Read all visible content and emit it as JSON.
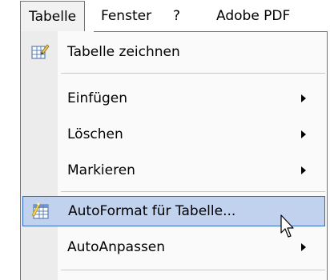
{
  "menubar": {
    "items": [
      {
        "label": "Tabelle"
      },
      {
        "label": "Fenster"
      },
      {
        "label": "?"
      },
      {
        "label": "Adobe PDF"
      }
    ]
  },
  "menu": {
    "items": [
      {
        "label": "Tabelle zeichnen",
        "icon": "pencil-table-icon"
      },
      {
        "label": "Einfügen",
        "submenu": true
      },
      {
        "label": "Löschen",
        "submenu": true
      },
      {
        "label": "Markieren",
        "submenu": true
      },
      {
        "label": "AutoFormat für Tabelle...",
        "icon": "autoformat-table-icon",
        "highlighted": true
      },
      {
        "label": "AutoAnpassen",
        "submenu": true
      }
    ]
  },
  "colors": {
    "highlight_fill": "#c1d2ee",
    "highlight_border": "#316ac5",
    "menu_border": "#737373"
  }
}
